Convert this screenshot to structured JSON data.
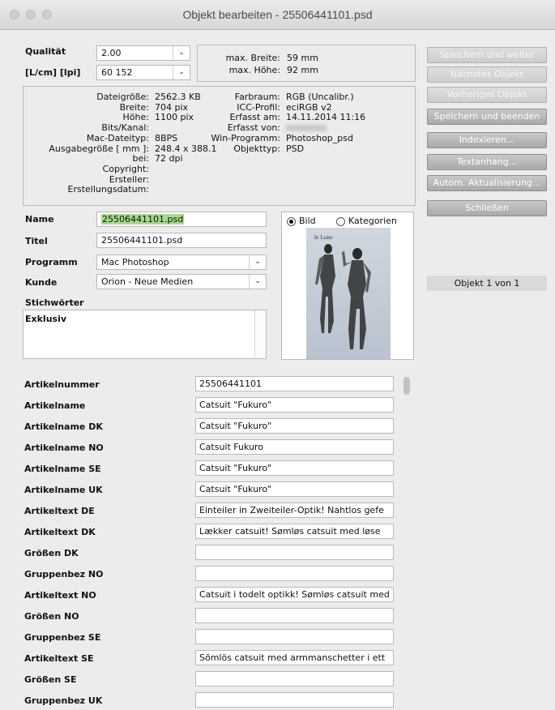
{
  "window": {
    "title": "Objekt bearbeiten - 25506441101.psd"
  },
  "top": {
    "qualitaet_label": "Qualität",
    "qualitaet_value": "2.00",
    "lcm_label": "[L/cm] [lpi]",
    "lcm_value": "60 152",
    "max_breite_label": "max. Breite:",
    "max_breite_value": "59 mm",
    "max_hoehe_label": "max. Höhe:",
    "max_hoehe_value": "92 mm"
  },
  "info_left": [
    {
      "label": "Dateigröße:",
      "value": "2562.3 KB"
    },
    {
      "label": "Breite:",
      "value": "704 pix"
    },
    {
      "label": "Höhe:",
      "value": "1100 pix"
    },
    {
      "label": "Bits/Kanal:",
      "value": ""
    },
    {
      "label": "Mac-Dateityp:",
      "value": "8BPS"
    },
    {
      "label": "Ausgabegröße [ mm ]:",
      "value": "248.4 x 388.1"
    },
    {
      "label": "bei:",
      "value": "72 dpi"
    },
    {
      "label": "Copyright:",
      "value": ""
    },
    {
      "label": "Ersteller:",
      "value": ""
    },
    {
      "label": "Erstellungsdatum:",
      "value": ""
    }
  ],
  "info_right": [
    {
      "label": "Farbraum:",
      "value": "RGB (Uncalibr.)"
    },
    {
      "label": "ICC-Profil:",
      "value": "eciRGB v2"
    },
    {
      "label": "Erfasst am:",
      "value": "14.11.2014 11:16"
    },
    {
      "label": "Erfasst von:",
      "value": ""
    },
    {
      "label": "Win-Programm:",
      "value": "Photoshop_psd"
    },
    {
      "label": "Objekttyp:",
      "value": "PSD"
    }
  ],
  "form": {
    "name_label": "Name",
    "name_value": "25506441101.psd",
    "titel_label": "Titel",
    "titel_value": "25506441101.psd",
    "programm_label": "Programm",
    "programm_value": "Mac Photoshop",
    "kunde_label": "Kunde",
    "kunde_value": "Orion - Neue Medien",
    "stichwoerter_label": "Stichwörter",
    "stichwoerter_value": "Exklusiv"
  },
  "preview": {
    "bild_label": "Bild",
    "kategorien_label": "Kategorien",
    "selected": "Bild"
  },
  "buttons": [
    {
      "label": "Speichern und weiter",
      "disabled": true
    },
    {
      "label": "Nächstes Objekt",
      "disabled": true
    },
    {
      "label": "Vorheriges Objekt",
      "disabled": true
    },
    {
      "label": "Speichern und beenden",
      "disabled": false
    },
    {
      "label": "Indexieren...",
      "disabled": false
    },
    {
      "label": "Textanhang...",
      "disabled": false
    },
    {
      "label": "Autom. Aktualisierung...",
      "disabled": false
    },
    {
      "label": "Schließen",
      "disabled": false
    }
  ],
  "counter": "Objekt 1 von 1",
  "fields": [
    {
      "label": "Artikelnummer",
      "value": "25506441101"
    },
    {
      "label": "Artikelname",
      "value": "Catsuit \"Fukuro\""
    },
    {
      "label": "Artikelname DK",
      "value": "Catsuit \"Fukuro\""
    },
    {
      "label": "Artikelname NO",
      "value": "Catsuit Fukuro"
    },
    {
      "label": "Artikelname SE",
      "value": "Catsuit \"Fukuro\""
    },
    {
      "label": "Artikelname UK",
      "value": "Catsuit \"Fukuro\""
    },
    {
      "label": "Artikeltext DE",
      "value": "Einteiler in Zweiteiler-Optik! Nahtlos gefe"
    },
    {
      "label": "Artikeltext DK",
      "value": "Lækker catsuit!  Sømløs catsuit med løse"
    },
    {
      "label": "Größen DK",
      "value": ""
    },
    {
      "label": "Gruppenbez NO",
      "value": ""
    },
    {
      "label": "Artikeltext NO",
      "value": "Catsuit i todelt optikk! Sømløs catsuit med"
    },
    {
      "label": "Größen NO",
      "value": ""
    },
    {
      "label": "Gruppenbez SE",
      "value": ""
    },
    {
      "label": "Artikeltext SE",
      "value": "Sömlös catsuit med armmanschetter i ett"
    },
    {
      "label": "Größen SE",
      "value": ""
    },
    {
      "label": "Gruppenbez UK",
      "value": ""
    }
  ]
}
